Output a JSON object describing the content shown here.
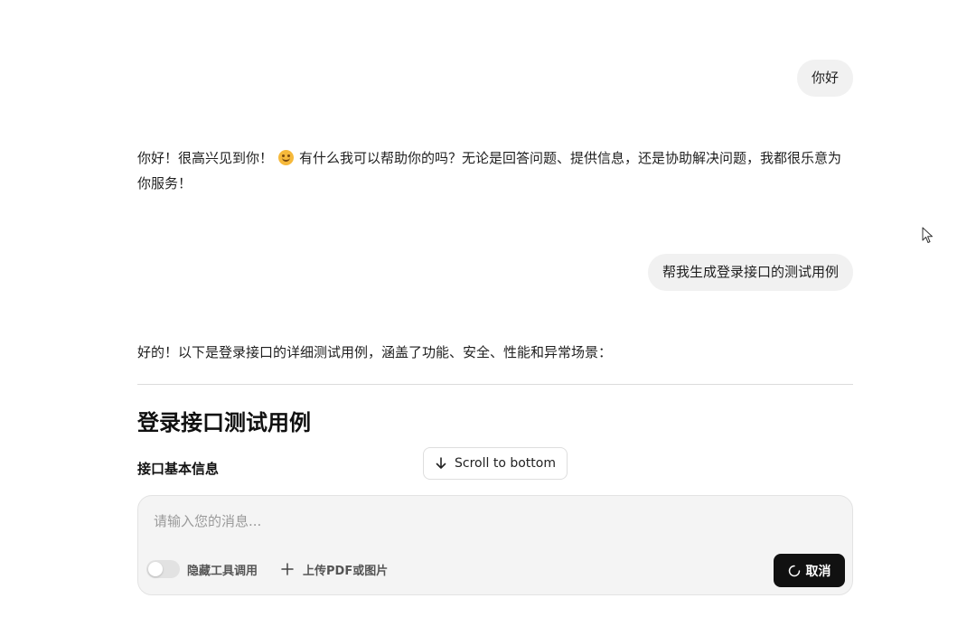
{
  "messages": [
    {
      "role": "user",
      "text": "你好"
    },
    {
      "role": "assistant",
      "text_before_emoji": "你好！很高兴见到你！",
      "emoji": "smiling-face-emoji",
      "text_after_emoji": "有什么我可以帮助你的吗？无论是回答问题、提供信息，还是协助解决问题，我都很乐意为你服务！"
    },
    {
      "role": "user",
      "text": "帮我生成登录接口的测试用例"
    },
    {
      "role": "assistant",
      "text": "好的！以下是登录接口的详细测试用例，涵盖了功能、安全、性能和异常场景：",
      "heading": "登录接口测试用例",
      "subheading": "接口基本信息"
    }
  ],
  "scroll_button": {
    "label": "Scroll to bottom",
    "icon": "arrow-down-icon"
  },
  "composer": {
    "placeholder": "请输入您的消息...",
    "value": "",
    "toggle": {
      "label": "隐藏工具调用",
      "state": "off"
    },
    "upload": {
      "label": "上传PDF或图片",
      "icon": "plus-icon"
    },
    "cancel": {
      "label": "取消",
      "icon": "spinner-icon"
    }
  },
  "colors": {
    "user_bubble": "#f1f1f1",
    "composer_bg": "#f4f4f4",
    "cancel_bg": "#111111",
    "emoji": "#f6b93b"
  }
}
